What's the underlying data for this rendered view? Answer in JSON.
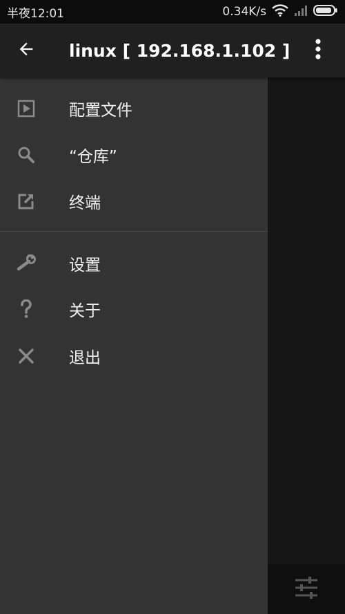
{
  "status_bar": {
    "time": "半夜12:01",
    "network_speed": "0.34K/s",
    "icons": [
      "wifi-icon",
      "signal-icon",
      "battery-icon"
    ]
  },
  "app_bar": {
    "title": "linux  [ 192.168.1.102 ]",
    "back_icon": "arrow-back-icon",
    "more_icon": "more-vert-icon"
  },
  "drawer": {
    "group1": [
      {
        "label": "配置文件",
        "icon": "play-box-icon"
      },
      {
        "label": "“仓库”",
        "icon": "search-icon"
      },
      {
        "label": "终端",
        "icon": "edit-icon"
      }
    ],
    "group2": [
      {
        "label": "设置",
        "icon": "wrench-icon"
      },
      {
        "label": "关于",
        "icon": "help-icon"
      },
      {
        "label": "退出",
        "icon": "close-icon"
      }
    ]
  },
  "bottom_bar": {
    "icon": "sliders-icon"
  },
  "colors": {
    "drawer_bg": "#333333",
    "app_bar_bg": "#202020",
    "status_bar_bg": "#0c0c0c",
    "icon_gray": "#8a8a8a"
  }
}
